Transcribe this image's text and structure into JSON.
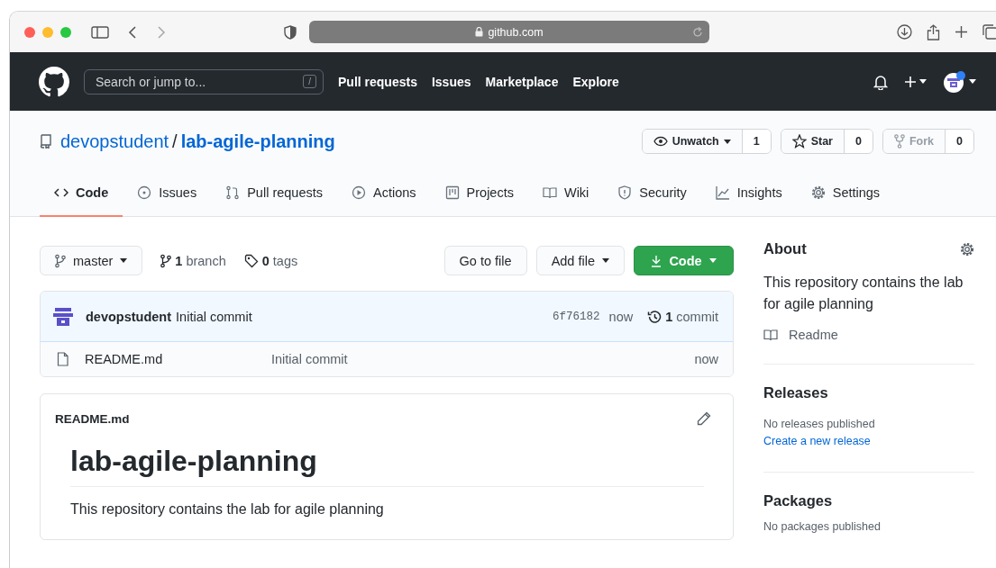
{
  "browser": {
    "url": "github.com"
  },
  "header": {
    "search_placeholder": "Search or jump to...",
    "search_key": "/",
    "nav": [
      "Pull requests",
      "Issues",
      "Marketplace",
      "Explore"
    ]
  },
  "repo": {
    "owner": "devopstudent",
    "separator": "/",
    "name": "lab-agile-planning",
    "actions": [
      {
        "label": "Unwatch",
        "count": "1",
        "dropdown": true,
        "disabled": false
      },
      {
        "label": "Star",
        "count": "0",
        "dropdown": false,
        "disabled": false
      },
      {
        "label": "Fork",
        "count": "0",
        "dropdown": false,
        "disabled": true
      }
    ]
  },
  "tabs": [
    {
      "label": "Code",
      "selected": true
    },
    {
      "label": "Issues",
      "selected": false
    },
    {
      "label": "Pull requests",
      "selected": false
    },
    {
      "label": "Actions",
      "selected": false
    },
    {
      "label": "Projects",
      "selected": false
    },
    {
      "label": "Wiki",
      "selected": false
    },
    {
      "label": "Security",
      "selected": false
    },
    {
      "label": "Insights",
      "selected": false
    },
    {
      "label": "Settings",
      "selected": false
    }
  ],
  "toolbar": {
    "branch": "master",
    "branch_count": "1",
    "branch_label": "branch",
    "tag_count": "0",
    "tag_label": "tags",
    "go_to_file": "Go to file",
    "add_file": "Add file",
    "code": "Code"
  },
  "commit": {
    "author": "devopstudent",
    "message": "Initial commit",
    "hash": "6f76182",
    "time": "now",
    "count": "1",
    "count_label": "commit"
  },
  "files": [
    {
      "name": "README.md",
      "message": "Initial commit",
      "time": "now"
    }
  ],
  "readme": {
    "filename": "README.md",
    "heading": "lab-agile-planning",
    "text": "This repository contains the lab for agile planning"
  },
  "sidebar": {
    "about_title": "About",
    "description": "This repository contains the lab for agile planning",
    "readme_link": "Readme",
    "releases_title": "Releases",
    "releases_note": "No releases published",
    "releases_link": "Create a new release",
    "packages_title": "Packages",
    "packages_note": "No packages published"
  }
}
